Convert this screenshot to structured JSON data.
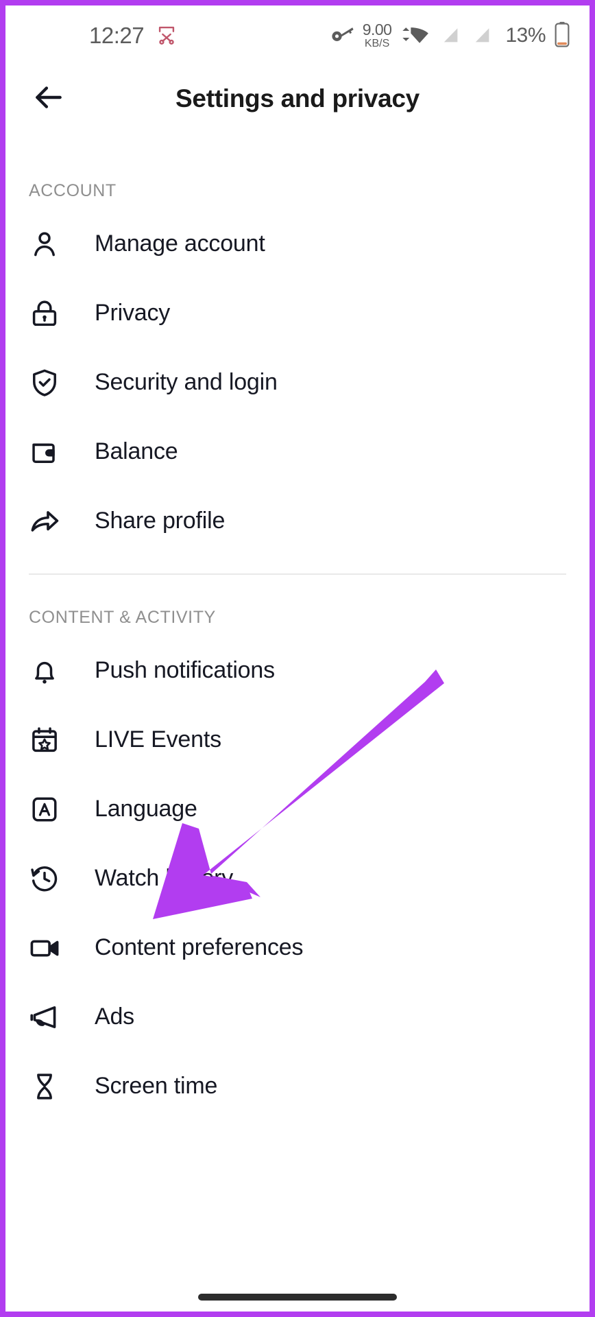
{
  "theme": {
    "frame_border_color": "#b23df0",
    "arrow_color": "#b23df0",
    "background": "#ffffff",
    "text_primary": "#161823",
    "text_muted": "#8f8f8f",
    "divider": "#e9e9e9",
    "screenshot_icon_color": "#c0566b"
  },
  "status_bar": {
    "time": "12:27",
    "screenshot_icon": "scissors-crop-icon",
    "vpn_icon": "key-icon",
    "network_speed_value": "9.00",
    "network_speed_unit": "KB/S",
    "wifi_icon": "wifi-icon",
    "sim1_icon": "no-sim-icon",
    "sim2_icon": "no-sim-icon",
    "battery_percent": "13%",
    "battery_icon": "battery-low-icon"
  },
  "header": {
    "back_icon": "arrow-left-icon",
    "title": "Settings and privacy"
  },
  "sections": [
    {
      "id": "account",
      "header": "ACCOUNT",
      "items": [
        {
          "label": "Manage account",
          "icon": "person-icon"
        },
        {
          "label": "Privacy",
          "icon": "lock-icon"
        },
        {
          "label": "Security and login",
          "icon": "shield-check-icon"
        },
        {
          "label": "Balance",
          "icon": "wallet-icon"
        },
        {
          "label": "Share profile",
          "icon": "share-arrow-icon"
        }
      ]
    },
    {
      "id": "content",
      "header": "CONTENT & ACTIVITY",
      "items": [
        {
          "label": "Push notifications",
          "icon": "bell-icon"
        },
        {
          "label": "LIVE Events",
          "icon": "calendar-star-icon"
        },
        {
          "label": "Language",
          "icon": "letter-a-box-icon"
        },
        {
          "label": "Watch history",
          "icon": "clock-history-icon"
        },
        {
          "label": "Content preferences",
          "icon": "video-camera-icon"
        },
        {
          "label": "Ads",
          "icon": "megaphone-icon"
        },
        {
          "label": "Screen time",
          "icon": "hourglass-icon"
        }
      ]
    }
  ],
  "annotation": {
    "type": "arrow",
    "points_to": "Language",
    "color": "#b23df0"
  },
  "system_nav": {
    "home_indicator": "home-indicator-bar"
  }
}
